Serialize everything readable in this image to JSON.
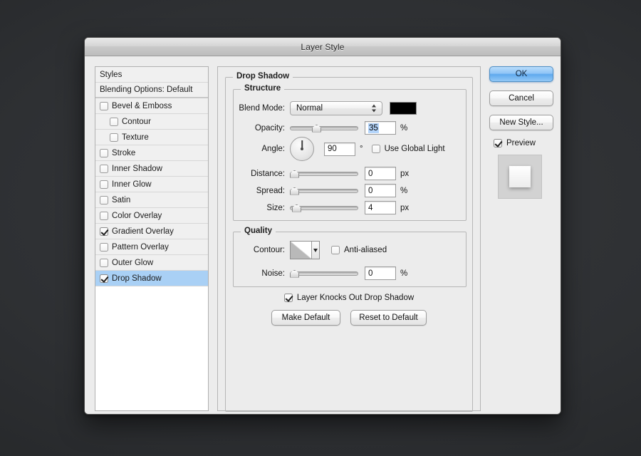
{
  "window": {
    "title": "Layer Style"
  },
  "styles_panel": {
    "header": "Styles",
    "blending_options": "Blending Options: Default",
    "items": [
      {
        "label": "Bevel & Emboss",
        "checked": false,
        "indent": false,
        "selected": false
      },
      {
        "label": "Contour",
        "checked": false,
        "indent": true,
        "selected": false
      },
      {
        "label": "Texture",
        "checked": false,
        "indent": true,
        "selected": false
      },
      {
        "label": "Stroke",
        "checked": false,
        "indent": false,
        "selected": false
      },
      {
        "label": "Inner Shadow",
        "checked": false,
        "indent": false,
        "selected": false
      },
      {
        "label": "Inner Glow",
        "checked": false,
        "indent": false,
        "selected": false
      },
      {
        "label": "Satin",
        "checked": false,
        "indent": false,
        "selected": false
      },
      {
        "label": "Color Overlay",
        "checked": false,
        "indent": false,
        "selected": false
      },
      {
        "label": "Gradient Overlay",
        "checked": true,
        "indent": false,
        "selected": false
      },
      {
        "label": "Pattern Overlay",
        "checked": false,
        "indent": false,
        "selected": false
      },
      {
        "label": "Outer Glow",
        "checked": false,
        "indent": false,
        "selected": false
      },
      {
        "label": "Drop Shadow",
        "checked": true,
        "indent": false,
        "selected": true
      }
    ]
  },
  "main": {
    "group_title": "Drop Shadow",
    "structure": {
      "title": "Structure",
      "blend_mode_label": "Blend Mode:",
      "blend_mode_value": "Normal",
      "color_swatch": "#000000",
      "opacity_label": "Opacity:",
      "opacity_value": "35",
      "opacity_unit": "%",
      "angle_label": "Angle:",
      "angle_value": "90",
      "angle_unit": "°",
      "use_global_light_label": "Use Global Light",
      "use_global_light_checked": false,
      "distance_label": "Distance:",
      "distance_value": "0",
      "distance_unit": "px",
      "spread_label": "Spread:",
      "spread_value": "0",
      "spread_unit": "%",
      "size_label": "Size:",
      "size_value": "4",
      "size_unit": "px"
    },
    "quality": {
      "title": "Quality",
      "contour_label": "Contour:",
      "anti_aliased_label": "Anti-aliased",
      "anti_aliased_checked": false,
      "noise_label": "Noise:",
      "noise_value": "0",
      "noise_unit": "%"
    },
    "layer_knocks_out_label": "Layer Knocks Out Drop Shadow",
    "layer_knocks_out_checked": true,
    "make_default_label": "Make Default",
    "reset_to_default_label": "Reset to Default"
  },
  "right": {
    "ok_label": "OK",
    "cancel_label": "Cancel",
    "new_style_label": "New Style...",
    "preview_label": "Preview",
    "preview_checked": true
  }
}
